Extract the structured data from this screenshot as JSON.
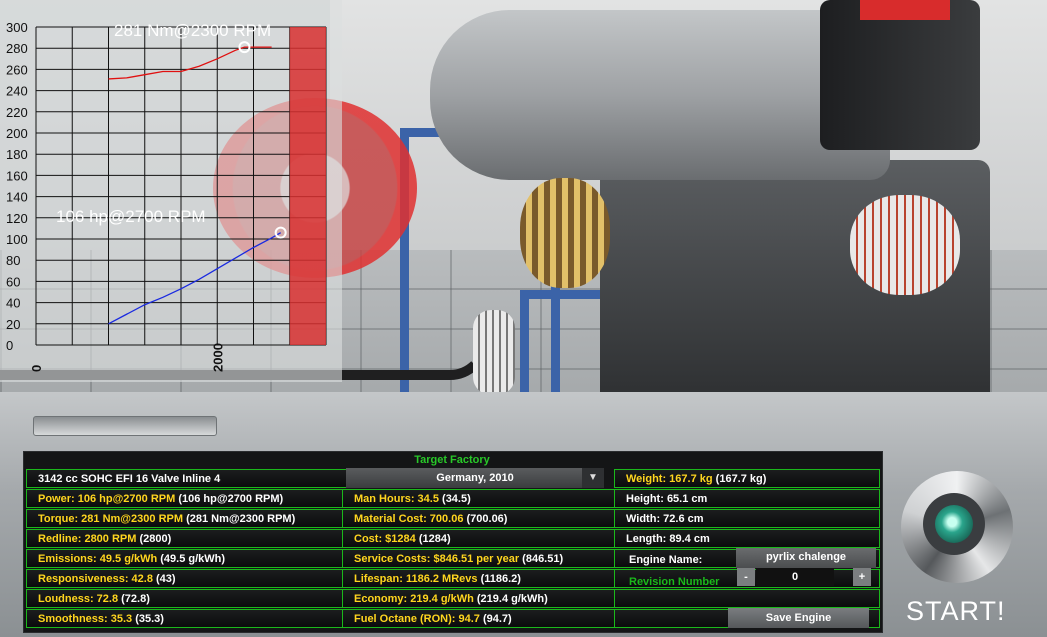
{
  "chart": {
    "torque_label": "281 Nm@2300 RPM",
    "power_label": "106 hp@2700 RPM",
    "y_ticks": [
      "300",
      "280",
      "260",
      "240",
      "220",
      "200",
      "180",
      "160",
      "140",
      "120",
      "100",
      "80",
      "60",
      "40",
      "20",
      "0"
    ],
    "x_ticks": [
      "0",
      "2000"
    ]
  },
  "chart_data": {
    "type": "line",
    "xlim": [
      0,
      3200
    ],
    "ylim": [
      0,
      300
    ],
    "grid": true,
    "series": [
      {
        "x": [
          800,
          1000,
          1200,
          1400,
          1600,
          1800,
          2000,
          2200,
          2300,
          2500,
          2600
        ],
        "values": [
          251,
          252,
          255,
          258,
          258,
          263,
          270,
          278,
          281,
          281,
          281
        ]
      },
      {
        "x": [
          800,
          1000,
          1200,
          1400,
          1600,
          1800,
          2000,
          2200,
          2400,
          2600,
          2700
        ],
        "values": [
          20,
          29,
          38,
          45,
          53,
          62,
          72,
          82,
          92,
          101,
          106
        ]
      }
    ],
    "redline_start": 2800,
    "annotations": [
      "281 Nm@2300 RPM",
      "106 hp@2700 RPM"
    ]
  },
  "table": {
    "header": "Target Factory",
    "col1": [
      {
        "text": "3142 cc SOHC EFI 16 Valve Inline 4",
        "highlight": ""
      },
      {
        "highlight": "Power: 106 hp@2700 RPM",
        "text": " (106 hp@2700 RPM)"
      },
      {
        "highlight": "Torque: 281 Nm@2300 RPM",
        "text": " (281 Nm@2300 RPM)"
      },
      {
        "highlight": "Redline: 2800 RPM",
        "text": " (2800)"
      },
      {
        "highlight": "Emissions: 49.5 g/kWh",
        "text": " (49.5 g/kWh)"
      },
      {
        "highlight": "Responsiveness: 42.8",
        "text": " (43)"
      },
      {
        "highlight": "Loudness: 72.8",
        "text": " (72.8)"
      },
      {
        "highlight": "Smoothness: 35.3",
        "text": " (35.3)"
      }
    ],
    "factory_select": "Germany, 2010",
    "col2": [
      {
        "highlight": "Man Hours: 34.5",
        "text": " (34.5)"
      },
      {
        "highlight": "Material Cost: 700.06",
        "text": " (700.06)"
      },
      {
        "highlight": "Cost: $1284",
        "text": " (1284)"
      },
      {
        "highlight": "Service Costs: $846.51 per year",
        "text": " (846.51)"
      },
      {
        "highlight": "Lifespan: 1186.2 MRevs",
        "text": " (1186.2)"
      },
      {
        "highlight": "Economy: 219.4 g/kWh",
        "text": " (219.4 g/kWh)"
      },
      {
        "highlight": "Fuel Octane (RON): 94.7",
        "text": " (94.7)"
      }
    ],
    "col3": [
      {
        "highlight": "Weight: 167.7 kg",
        "text": " (167.7 kg)"
      },
      {
        "highlight": "",
        "text": "Height: 65.1 cm"
      },
      {
        "highlight": "",
        "text": "Width: 72.6 cm"
      },
      {
        "highlight": "",
        "text": "Length: 89.4 cm"
      }
    ],
    "engine_name_label": "Engine Name:",
    "engine_name_value": "pyrlix chalenge",
    "revision_label": "Revision Number",
    "revision_value": "0",
    "minus_label": "-",
    "plus_label": "+",
    "save_label": "Save Engine",
    "dropdown_arrow": "▼"
  },
  "start_label": "START!",
  "colors": {
    "value_yellow": "#ffd61f",
    "grid_green": "#1bb81b",
    "torque": "#e01010",
    "power": "#1a2ae0",
    "redline": "#d83030"
  }
}
